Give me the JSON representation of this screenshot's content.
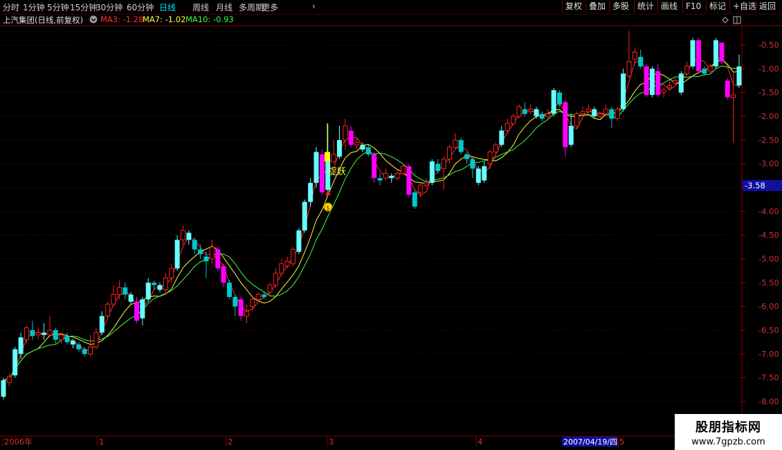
{
  "toolbar": {
    "periods": [
      "分时",
      "1分钟",
      "5分钟",
      "15分钟",
      "30分钟",
      "60分钟",
      "日线",
      "周线",
      "月线",
      "多周期",
      "更多"
    ],
    "active_period": "日线",
    "more_arrow": "›",
    "buttons": [
      "复权",
      "叠加",
      "多股",
      "统计",
      "画线",
      "F10",
      "标记",
      "+自选",
      "返回"
    ]
  },
  "info": {
    "title": "上汽集团(日线,前复权)",
    "ma3": "MA3: -1.28",
    "ma7": "MA7: -1.02",
    "ma10": "MA10: -0.93",
    "colors": {
      "ma3": "#ff3030",
      "ma7": "#ffff40",
      "ma10": "#40ff40"
    }
  },
  "annotations": {
    "signal_text": "捉妖",
    "current_price": "-3.58",
    "cursor_date": "2007/04/19/四"
  },
  "watermark": {
    "line1": "股朋指标网",
    "line2": "www.7gpzb.com"
  },
  "chart_data": {
    "type": "candlestick",
    "title": "上汽集团(日线,前复权)",
    "y_ticks": [
      "-0.50",
      "-1.00",
      "-1.50",
      "-2.00",
      "-2.50",
      "-3.00",
      "-3.50",
      "-4.00",
      "-4.50",
      "-5.00",
      "-5.50",
      "-6.00",
      "-6.50",
      "-7.00",
      "-7.50",
      "-8.00"
    ],
    "ylim": [
      -8.1,
      -0.1
    ],
    "x_labels": [
      "2006年",
      "1",
      "2",
      "3",
      "4",
      "5"
    ],
    "colors": {
      "up": "#ff2020",
      "down": "#00c8c8",
      "strong_up": "#ff00ff",
      "strong_down": "#66ffff",
      "signal": "#ffff00"
    },
    "candles": [
      [
        -7.9,
        -7.55,
        -7.95,
        -7.5
      ],
      [
        -7.6,
        -7.48,
        -7.68,
        -7.42
      ],
      [
        -7.45,
        -6.9,
        -7.5,
        -6.85
      ],
      [
        -7.0,
        -6.65,
        -7.1,
        -6.55
      ],
      [
        -6.7,
        -6.45,
        -6.78,
        -6.4
      ],
      [
        -6.5,
        -6.62,
        -6.7,
        -6.3
      ],
      [
        -6.6,
        -6.55,
        -6.68,
        -6.45
      ],
      [
        -6.55,
        -6.6,
        -6.7,
        -6.35
      ],
      [
        -6.6,
        -6.5,
        -6.65,
        -6.2
      ],
      [
        -6.5,
        -6.7,
        -6.78,
        -6.45
      ],
      [
        -6.7,
        -6.6,
        -6.78,
        -6.55
      ],
      [
        -6.62,
        -6.75,
        -6.8,
        -6.55
      ],
      [
        -6.72,
        -6.8,
        -6.88,
        -6.68
      ],
      [
        -6.8,
        -6.9,
        -6.95,
        -6.75
      ],
      [
        -6.9,
        -7.0,
        -7.05,
        -6.85
      ],
      [
        -7.0,
        -6.85,
        -7.05,
        -6.6
      ],
      [
        -6.85,
        -6.55,
        -6.9,
        -6.45
      ],
      [
        -6.55,
        -6.2,
        -6.6,
        -6.1
      ],
      [
        -6.2,
        -5.95,
        -6.25,
        -5.9
      ],
      [
        -5.95,
        -5.75,
        -6.0,
        -5.55
      ],
      [
        -5.75,
        -5.6,
        -5.85,
        -5.45
      ],
      [
        -5.6,
        -5.75,
        -5.85,
        -5.5
      ],
      [
        -5.75,
        -5.9,
        -5.95,
        -5.7
      ],
      [
        -5.9,
        -6.3,
        -6.35,
        -5.8
      ],
      [
        -6.25,
        -5.85,
        -6.4,
        -5.8
      ],
      [
        -5.85,
        -5.5,
        -5.9,
        -5.4
      ],
      [
        -5.5,
        -5.55,
        -5.65,
        -5.45
      ],
      [
        -5.55,
        -5.65,
        -5.7,
        -5.5
      ],
      [
        -5.65,
        -5.4,
        -5.75,
        -5.3
      ],
      [
        -5.4,
        -5.2,
        -5.5,
        -5.1
      ],
      [
        -5.2,
        -4.6,
        -5.25,
        -4.5
      ],
      [
        -4.6,
        -4.4,
        -4.7,
        -4.3
      ],
      [
        -4.45,
        -4.6,
        -4.7,
        -4.4
      ],
      [
        -4.6,
        -4.8,
        -4.9,
        -4.55
      ],
      [
        -4.8,
        -4.9,
        -5.0,
        -4.7
      ],
      [
        -4.95,
        -5.05,
        -5.4,
        -4.85
      ],
      [
        -5.0,
        -4.75,
        -5.1,
        -4.6
      ],
      [
        -4.8,
        -5.2,
        -5.25,
        -4.75
      ],
      [
        -5.15,
        -5.5,
        -5.6,
        -5.1
      ],
      [
        -5.5,
        -5.8,
        -5.85,
        -5.45
      ],
      [
        -5.8,
        -6.0,
        -6.2,
        -5.75
      ],
      [
        -5.85,
        -6.2,
        -6.3,
        -5.8
      ],
      [
        -6.2,
        -6.1,
        -6.35,
        -5.95
      ],
      [
        -6.0,
        -5.85,
        -6.1,
        -5.8
      ],
      [
        -5.85,
        -5.75,
        -5.9,
        -5.7
      ],
      [
        -5.75,
        -5.8,
        -5.85,
        -5.7
      ],
      [
        -5.7,
        -5.55,
        -5.8,
        -5.5
      ],
      [
        -5.55,
        -5.3,
        -5.6,
        -5.2
      ],
      [
        -5.3,
        -5.1,
        -5.35,
        -5.0
      ],
      [
        -5.15,
        -5.05,
        -5.2,
        -4.95
      ],
      [
        -5.1,
        -4.8,
        -5.15,
        -4.75
      ],
      [
        -4.85,
        -4.4,
        -4.9,
        -4.35
      ],
      [
        -4.4,
        -3.8,
        -4.45,
        -3.75
      ],
      [
        -3.8,
        -3.4,
        -3.9,
        -3.3
      ],
      [
        -3.4,
        -2.75,
        -3.5,
        -2.65
      ],
      [
        -2.8,
        -3.6,
        -3.65,
        -2.7
      ],
      [
        -3.55,
        -2.9,
        -3.6,
        -2.15
      ],
      [
        -2.95,
        -2.8,
        -3.0,
        -2.5
      ],
      [
        -2.85,
        -2.5,
        -2.9,
        -2.2
      ],
      [
        -2.5,
        -2.2,
        -2.7,
        -2.05
      ],
      [
        -2.3,
        -2.6,
        -2.65,
        -2.2
      ],
      [
        -2.6,
        -2.55,
        -2.7,
        -2.45
      ],
      [
        -2.6,
        -2.7,
        -2.75,
        -2.55
      ],
      [
        -2.65,
        -2.8,
        -2.85,
        -2.6
      ],
      [
        -2.8,
        -3.3,
        -3.4,
        -2.75
      ],
      [
        -3.3,
        -3.35,
        -3.45,
        -3.2
      ],
      [
        -3.3,
        -3.2,
        -3.35,
        -3.1
      ],
      [
        -3.25,
        -3.3,
        -3.4,
        -3.2
      ],
      [
        -3.3,
        -3.2,
        -3.35,
        -3.15
      ],
      [
        -3.2,
        -3.05,
        -3.25,
        -3.0
      ],
      [
        -3.05,
        -3.65,
        -3.7,
        -3.0
      ],
      [
        -3.6,
        -3.9,
        -3.95,
        -3.55
      ],
      [
        -3.6,
        -3.45,
        -3.7,
        -3.4
      ],
      [
        -3.45,
        -3.4,
        -3.5,
        -3.3
      ],
      [
        -3.4,
        -2.95,
        -3.45,
        -2.9
      ],
      [
        -3.0,
        -3.15,
        -3.2,
        -2.9
      ],
      [
        -3.1,
        -2.9,
        -3.55,
        -2.85
      ],
      [
        -2.9,
        -2.65,
        -3.0,
        -2.6
      ],
      [
        -2.65,
        -2.5,
        -2.7,
        -2.35
      ],
      [
        -2.5,
        -2.75,
        -2.8,
        -2.45
      ],
      [
        -2.8,
        -2.9,
        -3.0,
        -2.75
      ],
      [
        -2.9,
        -3.1,
        -3.3,
        -2.85
      ],
      [
        -3.1,
        -3.4,
        -3.45,
        -3.05
      ],
      [
        -3.35,
        -3.05,
        -3.4,
        -2.95
      ],
      [
        -3.0,
        -2.75,
        -3.1,
        -2.7
      ],
      [
        -2.75,
        -2.6,
        -2.8,
        -2.55
      ],
      [
        -2.6,
        -2.3,
        -2.65,
        -2.2
      ],
      [
        -2.3,
        -2.15,
        -2.35,
        -2.05
      ],
      [
        -2.15,
        -2.0,
        -2.2,
        -1.95
      ],
      [
        -2.0,
        -1.8,
        -2.05,
        -1.75
      ],
      [
        -1.85,
        -1.95,
        -2.0,
        -1.7
      ],
      [
        -1.9,
        -1.85,
        -1.95,
        -1.75
      ],
      [
        -1.85,
        -2.0,
        -2.05,
        -1.8
      ],
      [
        -1.95,
        -2.05,
        -2.1,
        -1.9
      ],
      [
        -2.0,
        -1.95,
        -2.05,
        -1.85
      ],
      [
        -1.95,
        -1.45,
        -2.0,
        -1.4
      ],
      [
        -1.5,
        -1.75,
        -1.8,
        -1.45
      ],
      [
        -1.7,
        -2.65,
        -2.85,
        -1.65
      ],
      [
        -2.6,
        -2.2,
        -2.65,
        -1.95
      ],
      [
        -2.2,
        -1.95,
        -2.25,
        -1.9
      ],
      [
        -1.95,
        -1.9,
        -2.0,
        -1.8
      ],
      [
        -1.9,
        -1.85,
        -1.95,
        -1.75
      ],
      [
        -1.85,
        -2.0,
        -2.05,
        -1.8
      ],
      [
        -2.0,
        -1.95,
        -2.05,
        -1.9
      ],
      [
        -1.95,
        -1.85,
        -2.0,
        -1.75
      ],
      [
        -1.85,
        -2.05,
        -2.25,
        -1.8
      ],
      [
        -2.05,
        -1.85,
        -2.1,
        -1.8
      ],
      [
        -1.85,
        -1.1,
        -1.9,
        -1.0
      ],
      [
        -1.15,
        -0.85,
        -1.2,
        -0.2
      ],
      [
        -0.8,
        -0.65,
        -0.9,
        -0.55
      ],
      [
        -0.75,
        -0.95,
        -1.0,
        -0.6
      ],
      [
        -0.95,
        -1.55,
        -1.6,
        -0.9
      ],
      [
        -1.55,
        -1.0,
        -1.6,
        -0.95
      ],
      [
        -1.05,
        -1.55,
        -1.6,
        -0.9
      ],
      [
        -1.5,
        -1.45,
        -1.6,
        -1.4
      ],
      [
        -1.4,
        -1.35,
        -1.45,
        -1.25
      ],
      [
        -1.3,
        -1.25,
        -1.35,
        -1.2
      ],
      [
        -1.5,
        -1.1,
        -1.55,
        -1.05
      ],
      [
        -1.1,
        -0.95,
        -1.15,
        -0.85
      ],
      [
        -0.95,
        -0.4,
        -1.0,
        -0.35
      ],
      [
        -0.4,
        -1.05,
        -1.1,
        -0.35
      ],
      [
        -1.0,
        -1.1,
        -1.15,
        -0.95
      ],
      [
        -1.05,
        -0.95,
        -1.1,
        -0.9
      ],
      [
        -0.95,
        -0.4,
        -1.0,
        -0.35
      ],
      [
        -0.45,
        -0.85,
        -0.9,
        -0.45
      ],
      [
        -1.25,
        -1.6,
        -1.65,
        -1.2
      ],
      [
        -1.6,
        -1.55,
        -2.55,
        -1.1
      ],
      [
        -1.35,
        -0.95,
        -1.4,
        -0.7
      ]
    ],
    "signal_candle": {
      "open": -2.75,
      "close": -2.95,
      "high": -2.15,
      "low": -3.0
    }
  }
}
